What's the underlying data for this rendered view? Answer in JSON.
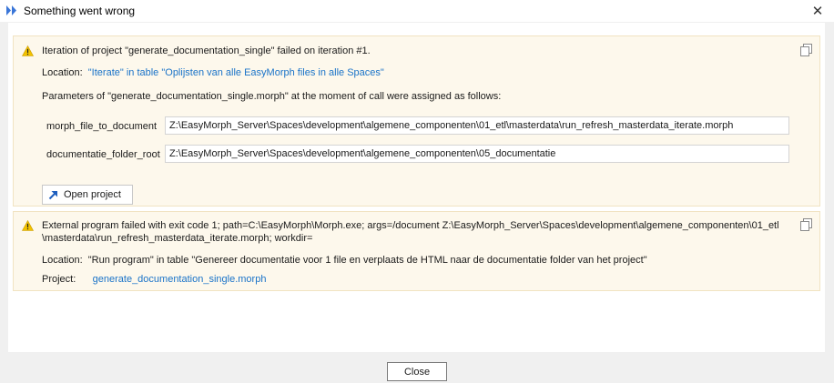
{
  "window": {
    "title": "Something went wrong",
    "close_glyph": "✕"
  },
  "error1": {
    "icon": "warning-icon",
    "message": "Iteration of project \"generate_documentation_single\" failed on iteration #1.",
    "location_label": "Location:",
    "location_value": "\"Iterate\" in table \"Oplijsten van alle EasyMorph files in alle Spaces\"",
    "params_heading": "Parameters of \"generate_documentation_single.morph\" at the moment of call were assigned as follows:",
    "params": [
      {
        "name": "morph_file_to_document",
        "value": "Z:\\EasyMorph_Server\\Spaces\\development\\algemene_componenten\\01_etl\\masterdata\\run_refresh_masterdata_iterate.morph"
      },
      {
        "name": "documentatie_folder_root",
        "value": "Z:\\EasyMorph_Server\\Spaces\\development\\algemene_componenten\\05_documentatie"
      }
    ],
    "open_button_label": "Open project"
  },
  "error2": {
    "icon": "warning-icon",
    "message_line1": "External program failed with exit code 1; path=C:\\EasyMorph\\Morph.exe; args=/document Z:\\EasyMorph_Server\\Spaces\\development\\algemene_componenten\\01_etl",
    "message_line2": "\\masterdata\\run_refresh_masterdata_iterate.morph; workdir=",
    "location_label": "Location:",
    "location_value": "\"Run program\" in table \"Genereer documentatie voor 1 file en verplaats de HTML naar de documentatie folder van het project\"",
    "project_label": "Project:",
    "project_value": "generate_documentation_single.morph"
  },
  "footer": {
    "close_label": "Close"
  },
  "colors": {
    "panel_bg": "#fdf8ec",
    "panel_border": "#f1e3c2",
    "link": "#1a73c8",
    "warning": "#f2c200"
  }
}
